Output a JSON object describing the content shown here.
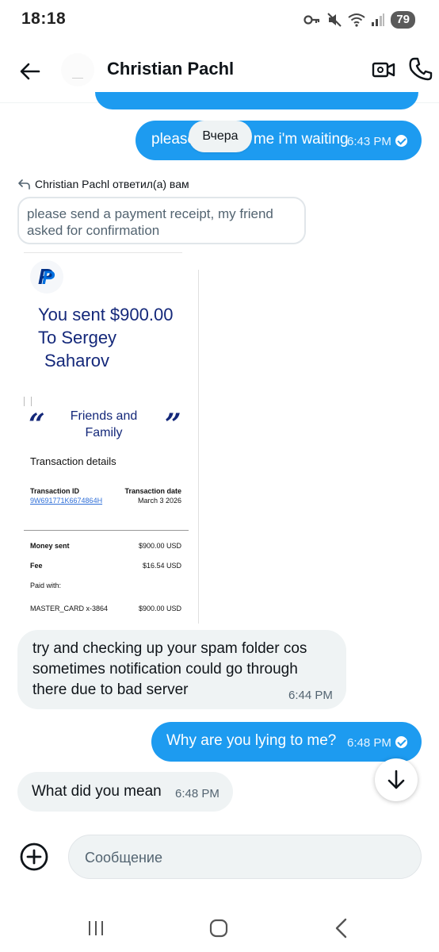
{
  "status_bar": {
    "time": "18:18",
    "battery": "79",
    "icons": [
      "key-icon",
      "mute-icon",
      "wifi-icon",
      "signal-icon",
      "battery-icon"
    ]
  },
  "header": {
    "contact_name": "Christian Pachl",
    "icons": [
      "back-arrow-icon",
      "video-call-icon",
      "phone-icon"
    ]
  },
  "date_separator": "Вчера",
  "messages": [
    {
      "direction": "out",
      "text": "please confirm me i'm waiting",
      "time": "6:43 PM",
      "read": true
    },
    {
      "direction": "in",
      "reply_label": "Christian Pachl ответил(а) вам",
      "quoted": "please send a payment receipt, my friend asked for confirmation"
    },
    {
      "direction": "in",
      "text": "try and checking up your spam folder cos sometimes notification could go through there due to bad server",
      "time": "6:44 PM"
    },
    {
      "direction": "out",
      "text": "Why are you lying to me?",
      "time": "6:48 PM",
      "read": true
    },
    {
      "direction": "in",
      "text": "What did you mean",
      "time": "6:48 PM"
    }
  ],
  "receipt": {
    "brand_icon": "paypal-logo",
    "title_lines": [
      "You sent $900.00",
      "To Sergey",
      "Saharov"
    ],
    "quote_open": "“",
    "quote_close": "”",
    "friends_family_lines": [
      "Friends and",
      "Family"
    ],
    "details_title": "Transaction details",
    "transaction_id_label": "Transaction ID",
    "transaction_id": "9W691771K6674864H",
    "transaction_date_label": "Transaction date",
    "transaction_date": "March 3 2026",
    "rows": [
      {
        "label": "Money sent",
        "value": "$900.00 USD",
        "bold": true
      },
      {
        "label": "Fee",
        "value": "$16.54 USD",
        "bold": true
      },
      {
        "label": "Paid with:",
        "value": "",
        "bold": false
      },
      {
        "label": "MASTER_CARD x-3864",
        "value": "$900.00 USD",
        "bold": false
      }
    ]
  },
  "composer": {
    "placeholder": "Сообщение"
  },
  "colors": {
    "accent": "#1d9bf0",
    "incoming_bubble": "#eff3f4",
    "paypal_navy": "#14287a"
  }
}
